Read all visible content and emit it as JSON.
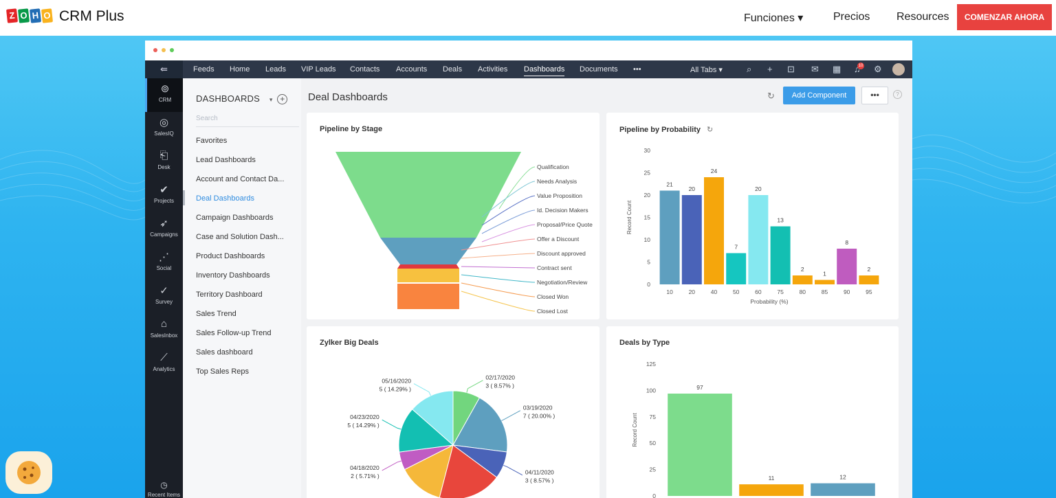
{
  "site": {
    "brand": "CRM Plus",
    "logo_letters": [
      "Z",
      "O",
      "H",
      "O"
    ],
    "logo_colors": [
      "#e42527",
      "#089949",
      "#226db4",
      "#f9b21d"
    ],
    "nav": {
      "funciones": "Funciones ▾",
      "precios": "Precios",
      "resources": "Resources"
    },
    "cta": "COMENZAR AHORA"
  },
  "app": {
    "tabs": [
      "Feeds",
      "Home",
      "Leads",
      "VIP Leads",
      "Contacts",
      "Accounts",
      "Deals",
      "Activities",
      "Dashboards",
      "Documents"
    ],
    "tabs_more": "•••",
    "all_tabs": "All Tabs ▾",
    "notification_count": "10",
    "leftbar": [
      {
        "label": "CRM",
        "icon": "crm-icon"
      },
      {
        "label": "SalesIQ",
        "icon": "salesiq-icon"
      },
      {
        "label": "Desk",
        "icon": "desk-icon"
      },
      {
        "label": "Projects",
        "icon": "projects-icon"
      },
      {
        "label": "Campaigns",
        "icon": "campaigns-icon"
      },
      {
        "label": "Social",
        "icon": "social-icon"
      },
      {
        "label": "Survey",
        "icon": "survey-icon"
      },
      {
        "label": "SalesInbox",
        "icon": "salesinbox-icon"
      },
      {
        "label": "Analytics",
        "icon": "analytics-icon"
      }
    ],
    "recent_items": "Recent Items"
  },
  "sidebar": {
    "title": "DASHBOARDS",
    "search_placeholder": "Search",
    "items": [
      "Favorites",
      "Lead Dashboards",
      "Account and Contact Da...",
      "Deal Dashboards",
      "Campaign Dashboards",
      "Case and Solution Dash...",
      "Product Dashboards",
      "Inventory Dashboards",
      "Territory Dashboard",
      "Sales Trend",
      "Sales Follow-up Trend",
      "Sales dashboard",
      "Top Sales Reps"
    ],
    "active_index": 3
  },
  "main": {
    "title": "Deal Dashboards",
    "add_component": "Add Component",
    "more": "•••",
    "help": "?"
  },
  "chart_data": [
    {
      "type": "funnel",
      "title": "Pipeline by Stage",
      "stages": [
        "Qualification",
        "Needs Analysis",
        "Value Proposition",
        "Id. Decision Makers",
        "Proposal/Price Quote",
        "Offer a Discount",
        "Discount approved",
        "Contract sent",
        "Negotiation/Review",
        "Closed Won",
        "Closed Lost"
      ],
      "colors": [
        "#7ddc8c",
        "#5e9fbf",
        "#e0393e",
        "#f7c13f",
        "#f9843f"
      ]
    },
    {
      "type": "bar",
      "title": "Pipeline by Probability",
      "categories": [
        "10",
        "20",
        "40",
        "50",
        "60",
        "75",
        "80",
        "85",
        "90",
        "95"
      ],
      "values": [
        21,
        20,
        24,
        7,
        20,
        13,
        2,
        1,
        8,
        2
      ],
      "colors": [
        "#5e9fbf",
        "#4a63b8",
        "#f5a60c",
        "#15c6c0",
        "#85e8f0",
        "#13bfb2",
        "#f5a60c",
        "#f5a60c",
        "#bf5cbf",
        "#f5a60c"
      ],
      "xlabel": "Probability (%)",
      "ylabel": "Record Count",
      "ylim": [
        0,
        30
      ],
      "yticks": [
        0,
        5,
        10,
        15,
        20,
        25,
        30
      ]
    },
    {
      "type": "pie",
      "title": "Zylker Big Deals",
      "slices": [
        {
          "label": "02/17/2020",
          "detail": "3 ( 8.57% )",
          "value": 8.57,
          "color": "#72d67e"
        },
        {
          "label": "03/19/2020",
          "detail": "7 ( 20.00% )",
          "value": 20.0,
          "color": "#5e9fbf"
        },
        {
          "label": "04/11/2020",
          "detail": "3 ( 8.57% )",
          "value": 8.57,
          "color": "#4a63b8"
        },
        {
          "label": "",
          "detail": "",
          "value": 20.0,
          "color": "#e8463c"
        },
        {
          "label": "",
          "detail": "",
          "value": 14.29,
          "color": "#f5b83a"
        },
        {
          "label": "04/18/2020",
          "detail": "2 ( 5.71% )",
          "value": 5.71,
          "color": "#c05cc3"
        },
        {
          "label": "04/23/2020",
          "detail": "5 ( 14.29% )",
          "value": 14.29,
          "color": "#13bfb2"
        },
        {
          "label": "05/16/2020",
          "detail": "5 ( 14.29% )",
          "value": 14.29,
          "color": "#85e8f0"
        }
      ]
    },
    {
      "type": "bar",
      "title": "Deals by Type",
      "values": [
        97,
        11,
        12
      ],
      "colors": [
        "#7ddc8c",
        "#f5a60c",
        "#5e9fbf"
      ],
      "ylabel": "Record Count",
      "ylim": [
        0,
        125
      ],
      "yticks": [
        0,
        25,
        50,
        75,
        100,
        125
      ]
    }
  ]
}
